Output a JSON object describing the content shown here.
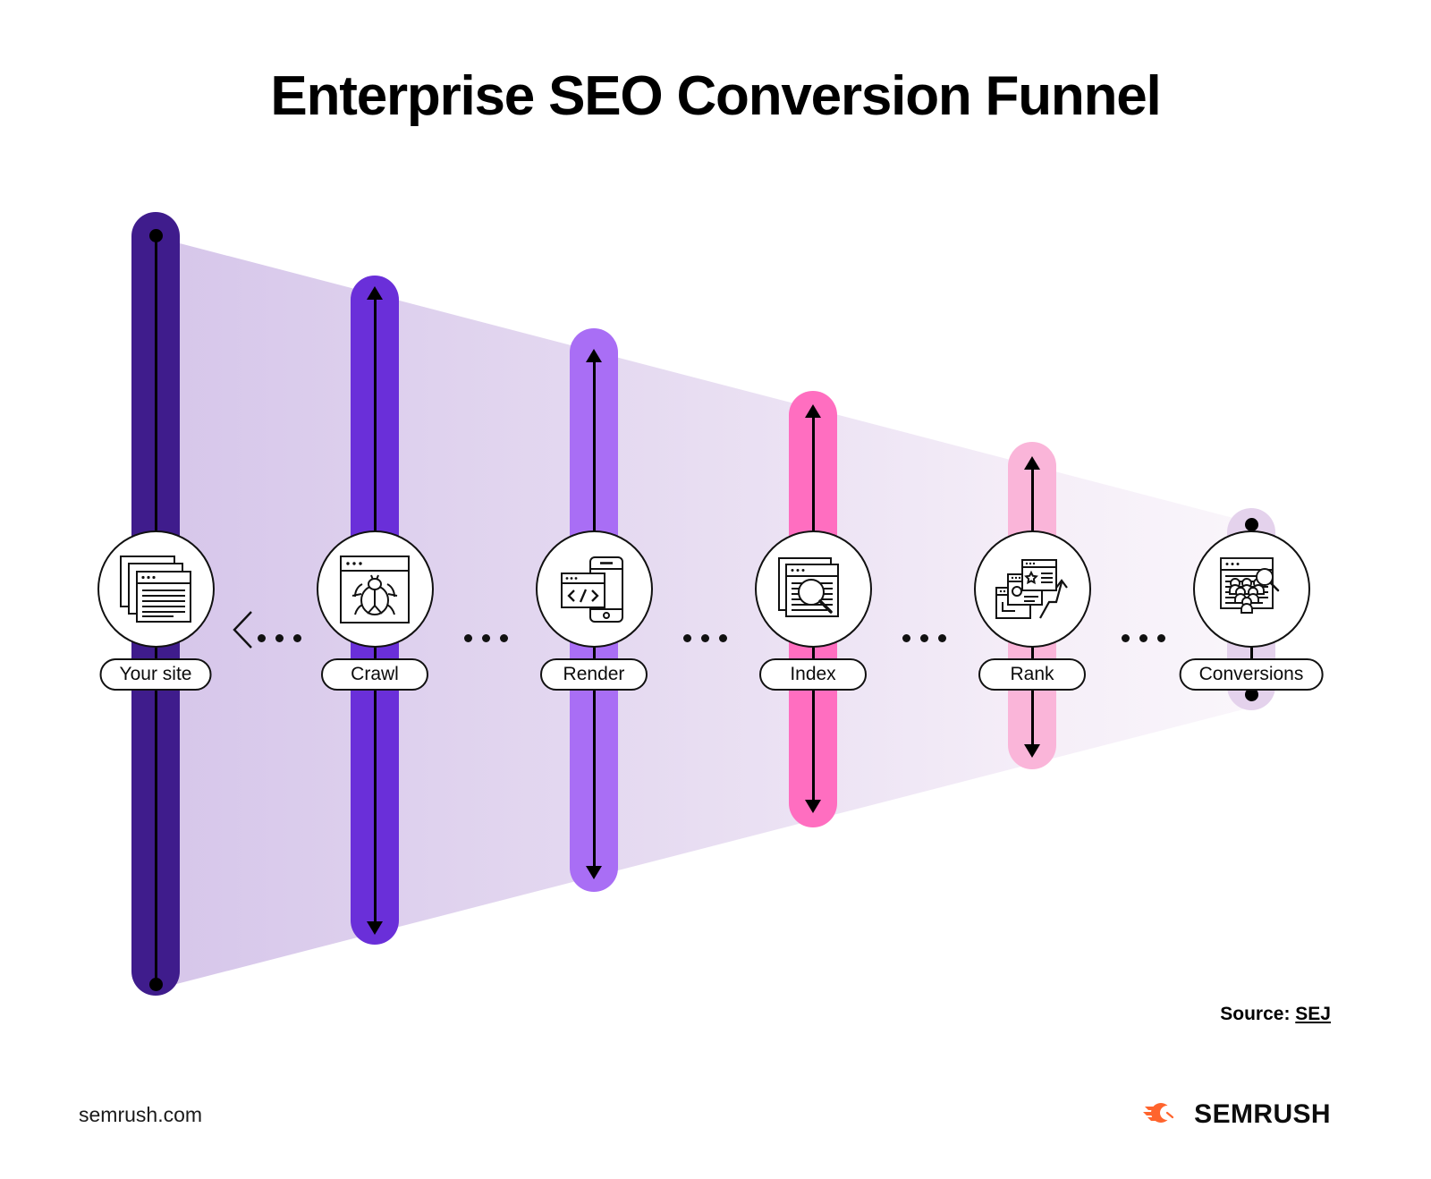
{
  "title": "Enterprise SEO Conversion Funnel",
  "colors": {
    "stage1_bar": "#3F1C8C",
    "stage2_bar": "#6A2FD9",
    "stage3_bar": "#A96EF5",
    "stage4_bar": "#FF6EC0",
    "stage5_bar": "#FAB5D9",
    "stage6_bar": "#E4D2EC",
    "funnel_start": "#D9CBEC",
    "funnel_end": "#F8F3FA",
    "brand_orange": "#FF642D",
    "ink": "#000000"
  },
  "stages": [
    {
      "id": "your-site",
      "label": "Your site",
      "icon": "stacked-documents-icon",
      "bar_color": "#3F1C8C",
      "marker_top": "dot",
      "marker_bottom": "dot"
    },
    {
      "id": "crawl",
      "label": "Crawl",
      "icon": "spider-bug-browser-icon",
      "bar_color": "#6A2FD9",
      "marker_top": "arrow-up",
      "marker_bottom": "arrow-down"
    },
    {
      "id": "render",
      "label": "Render",
      "icon": "code-window-mobile-icon",
      "bar_color": "#A96EF5",
      "marker_top": "arrow-up",
      "marker_bottom": "arrow-down"
    },
    {
      "id": "index",
      "label": "Index",
      "icon": "document-magnifier-icon",
      "bar_color": "#FF6EC0",
      "marker_top": "arrow-up",
      "marker_bottom": "arrow-down"
    },
    {
      "id": "rank",
      "label": "Rank",
      "icon": "ranking-cards-growth-arrow-icon",
      "bar_color": "#FAB5D9",
      "marker_top": "arrow-up",
      "marker_bottom": "arrow-down"
    },
    {
      "id": "conversions",
      "label": "Conversions",
      "icon": "audience-funnel-magnifier-icon",
      "bar_color": "#E4D2EC",
      "marker_top": "dot",
      "marker_bottom": "dot"
    }
  ],
  "connectors": [
    {
      "id": "your-site-to-crawl",
      "glyph": "left-chevron-with-dots",
      "dots": 3
    },
    {
      "id": "crawl-to-render",
      "glyph": "dots",
      "dots": 3
    },
    {
      "id": "render-to-index",
      "glyph": "dots",
      "dots": 3
    },
    {
      "id": "index-to-rank",
      "glyph": "dots",
      "dots": 3
    },
    {
      "id": "rank-to-conversions",
      "glyph": "dots",
      "dots": 3
    }
  ],
  "footer": {
    "source_label": "Source:",
    "source_link": "SEJ",
    "site_url": "semrush.com",
    "brand_name": "SEMRUSH",
    "brand_logo_icon": "semrush-comet-icon"
  }
}
